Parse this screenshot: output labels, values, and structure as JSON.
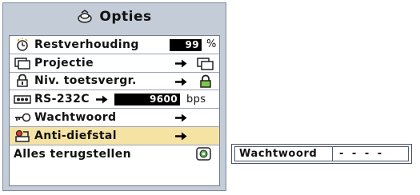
{
  "menu": {
    "title": "Opties",
    "items": [
      {
        "label": "Restverhouding",
        "value": "99",
        "unit": "%"
      },
      {
        "label": "Projectie"
      },
      {
        "label": "Niv. toetsvergr."
      },
      {
        "label": "RS-232C",
        "value": "9600",
        "unit": "bps"
      },
      {
        "label": "Wachtwoord"
      },
      {
        "label": "Anti-diefstal",
        "selected": true
      },
      {
        "label": "Alles terugstellen"
      }
    ]
  },
  "password_panel": {
    "label": "Wachtwoord",
    "value": "- - - -"
  },
  "colors": {
    "osd_background": "#c4ccd7",
    "selected_row": "#f5e3a4",
    "value_box": "#000000"
  },
  "icons": [
    "options-icon",
    "lamp-timer-icon",
    "projection-icon",
    "lock-icon",
    "serial-port-icon",
    "key-icon",
    "anti-theft-icon",
    "reset-icon",
    "arrow-right-icon"
  ]
}
